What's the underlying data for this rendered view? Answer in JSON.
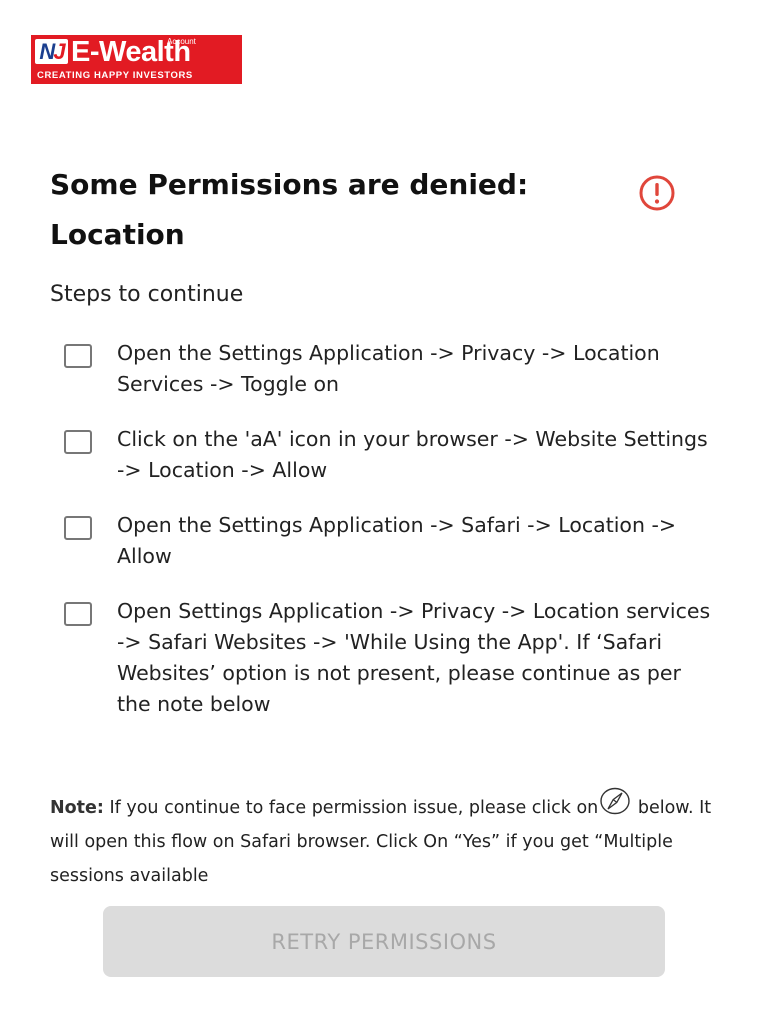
{
  "logo": {
    "mark_n": "N",
    "mark_j": "J",
    "name": "E-Wealth",
    "account": "Account",
    "tagline": "CREATING HAPPY INVESTORS"
  },
  "heading": {
    "line1": "Some Permissions are denied:",
    "line2": "Location",
    "icon": "alert-circle-icon",
    "icon_color": "#e0463b"
  },
  "steps_title": "Steps to continue",
  "steps": [
    {
      "checked": false,
      "text": "Open the Settings Application -> Privacy -> Location Services -> Toggle on"
    },
    {
      "checked": false,
      "text": "Click on the 'aA' icon in your browser -> Website Settings -> Location -> Allow"
    },
    {
      "checked": false,
      "text": "Open the Settings Application -> Safari -> Location -> Allow"
    },
    {
      "checked": false,
      "text": "Open Settings Application -> Privacy -> Location services -> Safari Websites -> 'While Using the App'. If ‘Safari Websites’ option is not present, please continue as per the note below"
    }
  ],
  "note": {
    "label": "Note:",
    "text_before": " If you continue to face permission issue, please click on",
    "icon": "safari-compass-icon",
    "text_after": " below. It will open this flow on Safari browser. Click On “Yes” if you get “Multiple sessions available"
  },
  "retry_button": "RETRY PERMISSIONS",
  "colors": {
    "brand_red": "#e21b23",
    "button_bg": "#dcdcdc",
    "button_text": "#a8a8a8"
  }
}
